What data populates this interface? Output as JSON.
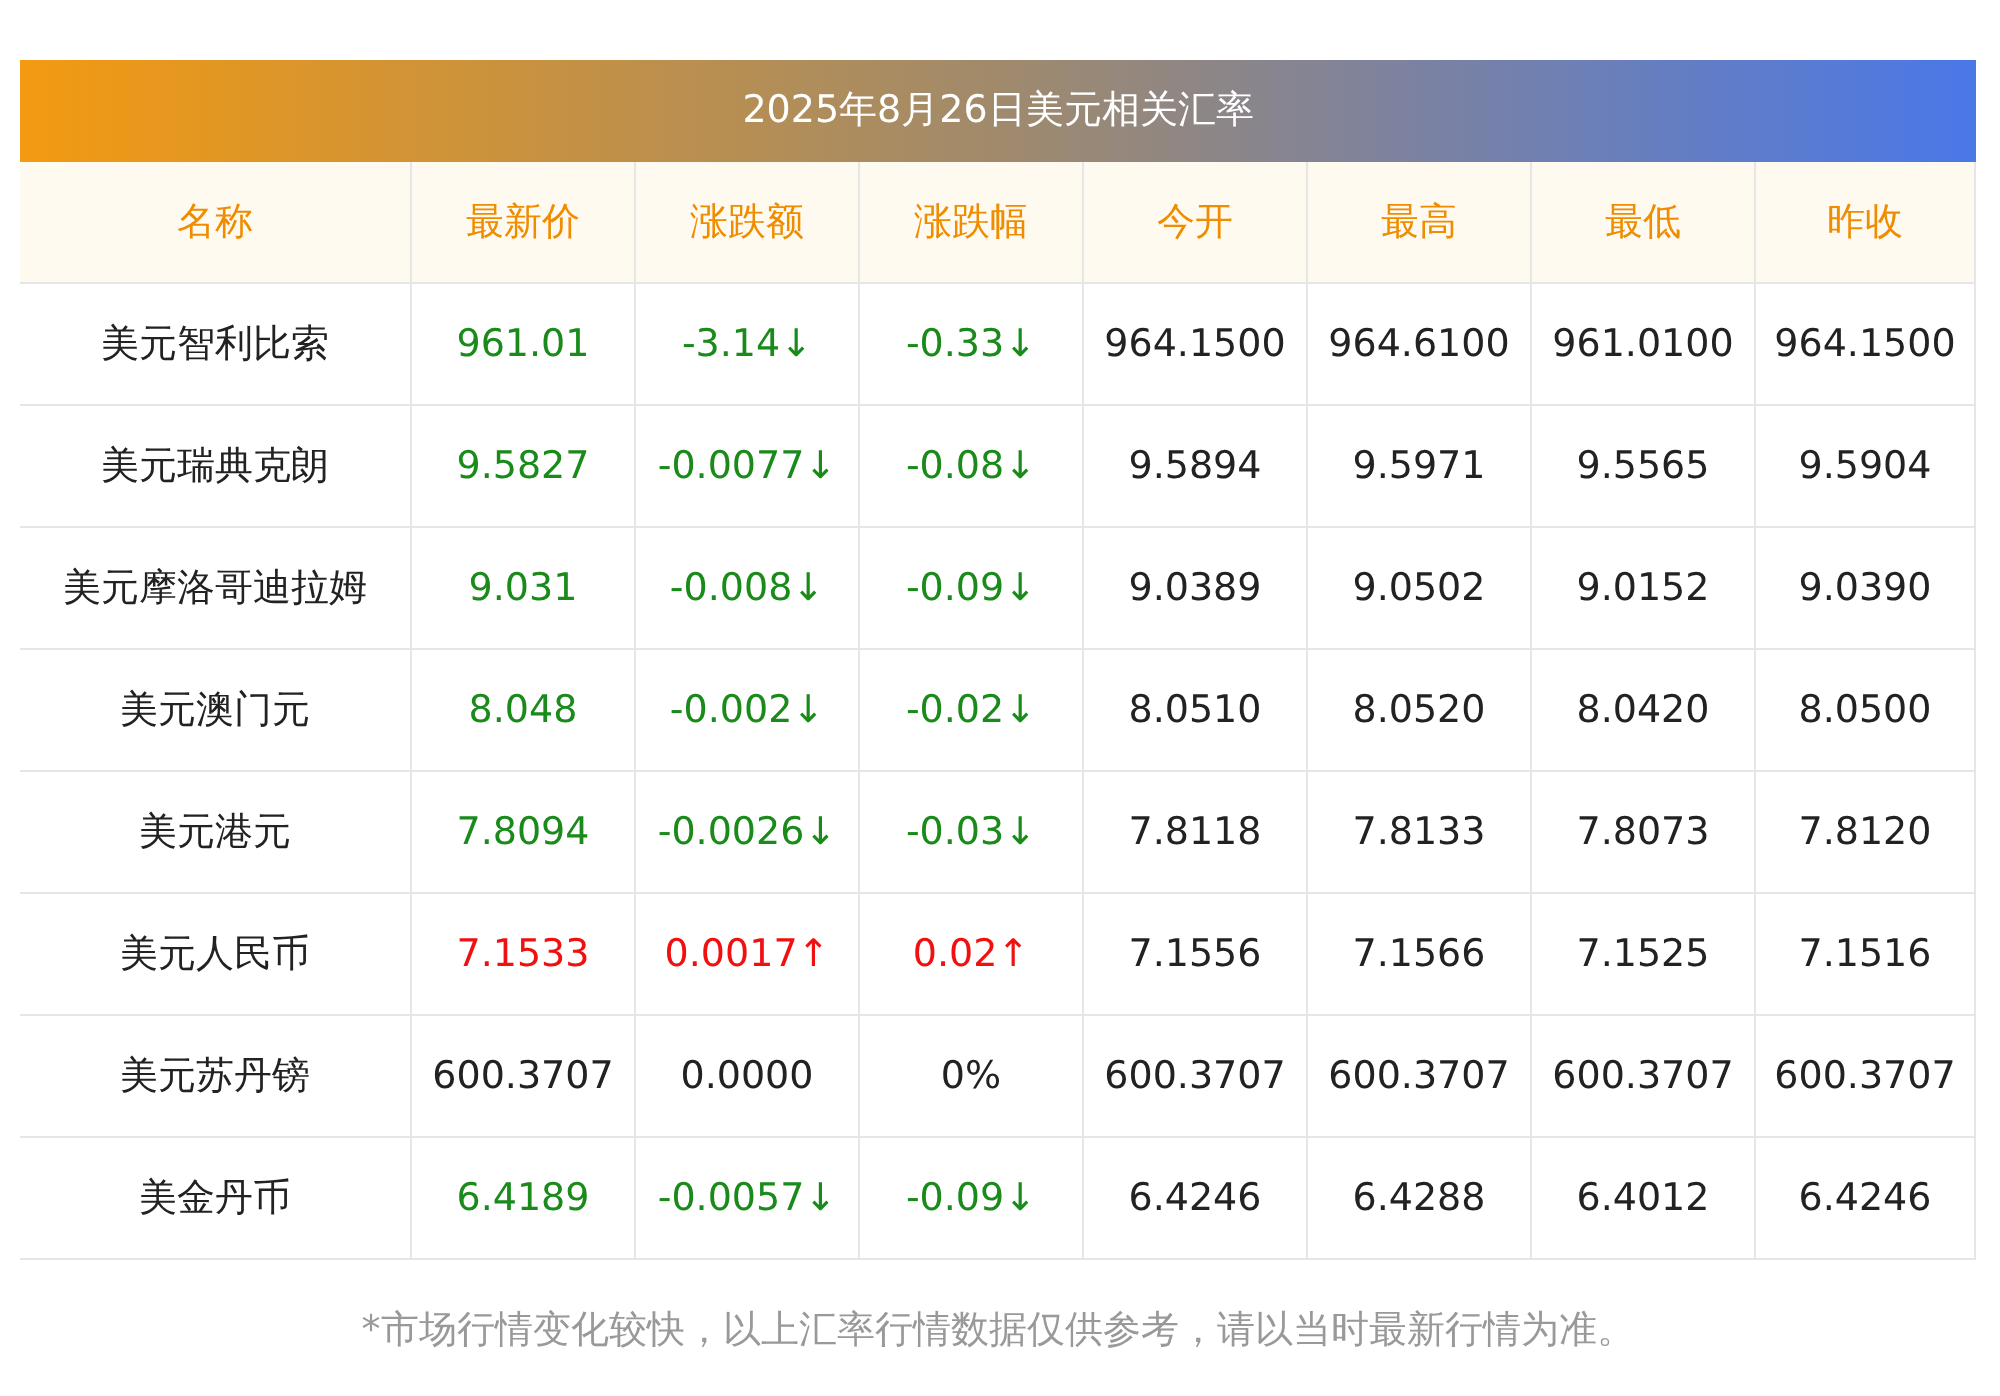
{
  "title": "2025年8月26日美元相关汇率",
  "columns": [
    "名称",
    "最新价",
    "涨跌额",
    "涨跌幅",
    "今开",
    "最高",
    "最低",
    "昨收"
  ],
  "rows": [
    {
      "name": "美元智利比索",
      "kind": "down",
      "price": "961.01",
      "change": "-3.14↓",
      "percent": "-0.33↓",
      "open": "964.1500",
      "high": "964.6100",
      "low": "961.0100",
      "prev_close": "964.1500"
    },
    {
      "name": "美元瑞典克朗",
      "kind": "down",
      "price": "9.5827",
      "change": "-0.0077↓",
      "percent": "-0.08↓",
      "open": "9.5894",
      "high": "9.5971",
      "low": "9.5565",
      "prev_close": "9.5904"
    },
    {
      "name": "美元摩洛哥迪拉姆",
      "kind": "down",
      "price": "9.031",
      "change": "-0.008↓",
      "percent": "-0.09↓",
      "open": "9.0389",
      "high": "9.0502",
      "low": "9.0152",
      "prev_close": "9.0390"
    },
    {
      "name": "美元澳门元",
      "kind": "down",
      "price": "8.048",
      "change": "-0.002↓",
      "percent": "-0.02↓",
      "open": "8.0510",
      "high": "8.0520",
      "low": "8.0420",
      "prev_close": "8.0500"
    },
    {
      "name": "美元港元",
      "kind": "down",
      "price": "7.8094",
      "change": "-0.0026↓",
      "percent": "-0.03↓",
      "open": "7.8118",
      "high": "7.8133",
      "low": "7.8073",
      "prev_close": "7.8120"
    },
    {
      "name": "美元人民币",
      "kind": "up",
      "price": "7.1533",
      "change": "0.0017↑",
      "percent": "0.02↑",
      "open": "7.1556",
      "high": "7.1566",
      "low": "7.1525",
      "prev_close": "7.1516"
    },
    {
      "name": "美元苏丹镑",
      "kind": "flat",
      "price": "600.3707",
      "change": "0.0000",
      "percent": "0%",
      "open": "600.3707",
      "high": "600.3707",
      "low": "600.3707",
      "prev_close": "600.3707"
    },
    {
      "name": "美金丹币",
      "kind": "down",
      "price": "6.4189",
      "change": "-0.0057↓",
      "percent": "-0.09↓",
      "open": "6.4246",
      "high": "6.4288",
      "low": "6.4012",
      "prev_close": "6.4246"
    }
  ],
  "footnote": "*市场行情变化较快，以上汇率行情数据仅供参考，请以当时最新行情为准。"
}
